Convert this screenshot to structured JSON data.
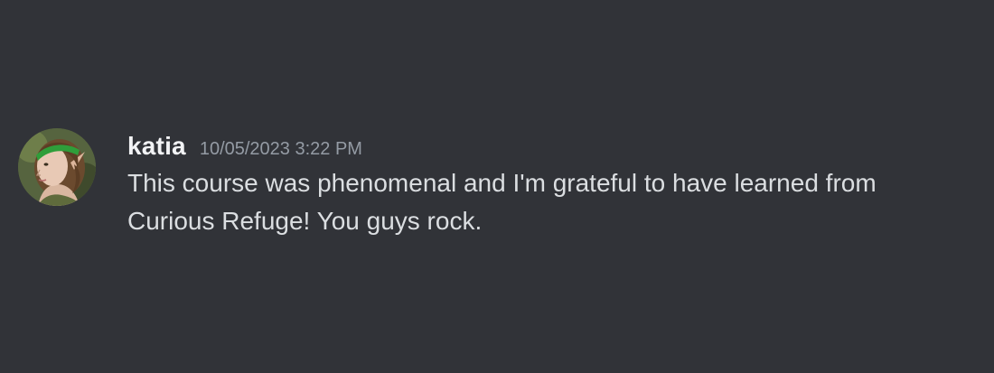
{
  "message": {
    "avatar_icon": "user-avatar-elf-woman",
    "username": "katia",
    "timestamp": "10/05/2023 3:22 PM",
    "text": "This course was phenomenal and I'm grateful to have learned from\nCurious Refuge! You guys rock."
  },
  "colors": {
    "background": "#313338",
    "username": "#f2f3f5",
    "timestamp": "#949ba4",
    "text": "#dbdee1",
    "avatar_accent": "#2f9e3a"
  }
}
